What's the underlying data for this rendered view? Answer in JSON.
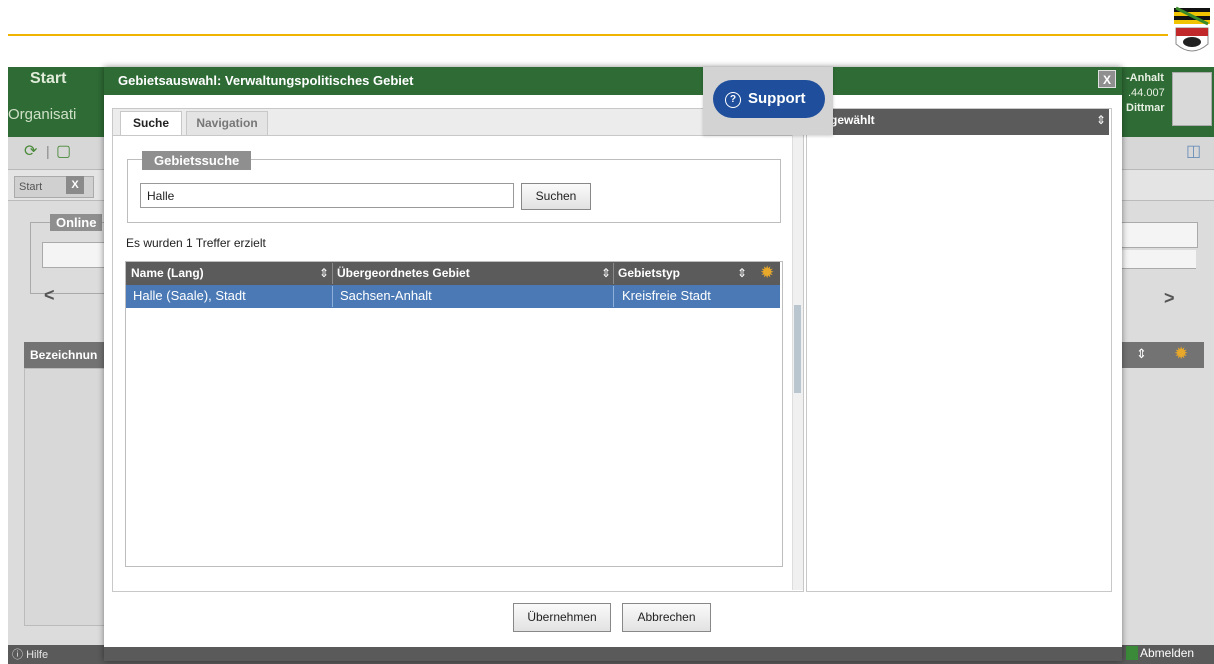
{
  "header": {
    "accent_color": "#f0b400"
  },
  "background_app": {
    "title": "Start",
    "subtitle": "Organisati",
    "user_lines": [
      "-Anhalt",
      ".44.007",
      "Dittmar"
    ],
    "tab_label": "Start",
    "tab_close": "X",
    "online_label": "Online",
    "grid_header": "Bezeichnun",
    "help_label": "Hilfe",
    "logout_label": "Abmelden",
    "bar_color": "#2e6b35"
  },
  "dialog": {
    "title": "Gebietsauswahl: Verwaltungspolitisches Gebiet",
    "close_label": "X",
    "tabs": [
      {
        "label": "Suche",
        "active": true
      },
      {
        "label": "Navigation",
        "active": false
      }
    ],
    "search": {
      "legend": "Gebietssuche",
      "value": "Halle",
      "button": "Suchen"
    },
    "result_text": "Es wurden 1 Treffer erzielt",
    "columns": [
      "Name (Lang)",
      "Übergeordnetes Gebiet",
      "Gebietstyp"
    ],
    "rows": [
      [
        "Halle (Saale), Stadt",
        "Sachsen-Anhalt",
        "Kreisfreie Stadt"
      ]
    ],
    "selected_header": "gewählt",
    "support_label": "Support",
    "buttons": {
      "accept": "Übernehmen",
      "cancel": "Abbrechen"
    },
    "selection_color": "#4a79b5"
  }
}
